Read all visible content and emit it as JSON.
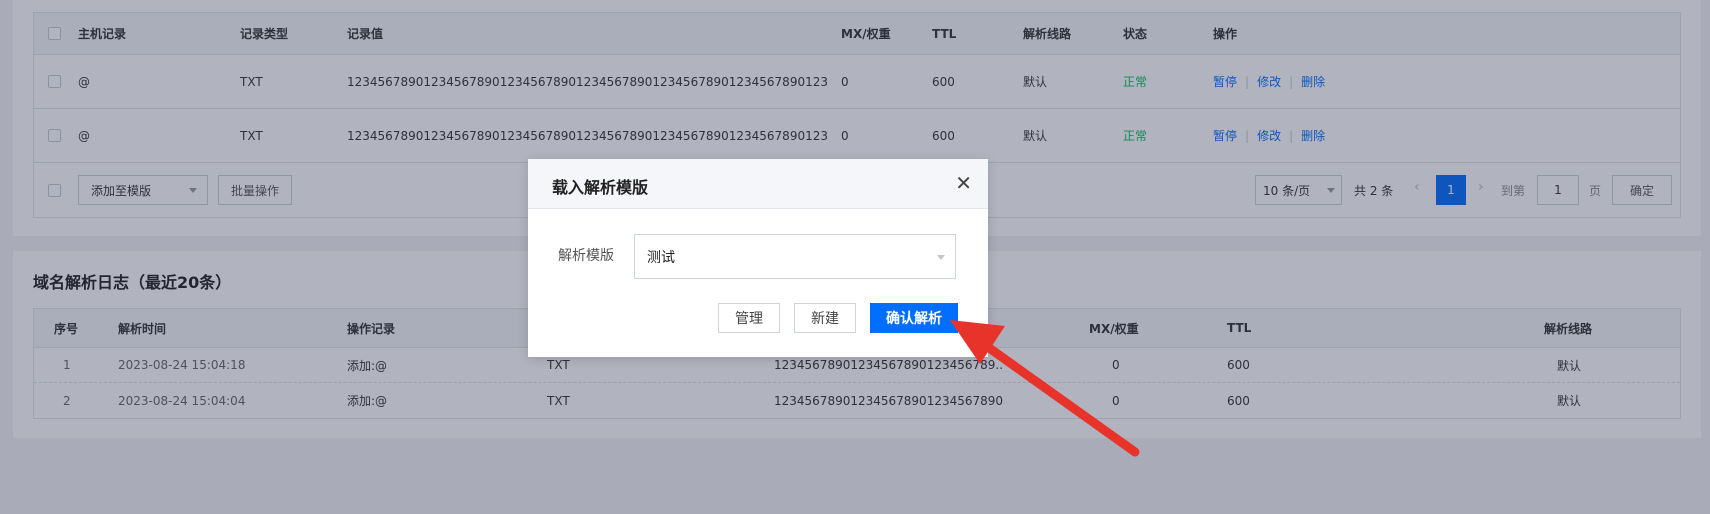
{
  "records_table": {
    "headers": {
      "host": "主机记录",
      "type": "记录类型",
      "value": "记录值",
      "mx": "MX/权重",
      "ttl": "TTL",
      "line": "解析线路",
      "status": "状态",
      "ops": "操作"
    },
    "rows": [
      {
        "host": "@",
        "type": "TXT",
        "value": "12345678901234567890123456789012345678901234567890123456789012345...",
        "mx": "0",
        "ttl": "600",
        "line": "默认",
        "status": "正常"
      },
      {
        "host": "@",
        "type": "TXT",
        "value": "12345678901234567890123456789012345678901234567890123456789012345...",
        "mx": "0",
        "ttl": "600",
        "line": "默认",
        "status": "正常"
      }
    ],
    "ops": {
      "pause": "暂停",
      "edit": "修改",
      "delete": "删除"
    },
    "footer": {
      "add_template": "添加至模版",
      "batch": "批量操作",
      "page_size": "10 条/页",
      "total": "共 2 条",
      "current_page": "1",
      "goto": "到第",
      "goto_value": "1",
      "page_unit": "页",
      "confirm": "确定"
    }
  },
  "log": {
    "title": "域名解析日志（最近20条）",
    "headers": {
      "no": "序号",
      "time": "解析时间",
      "action": "操作记录",
      "mx": "MX/权重",
      "ttl": "TTL",
      "line": "解析线路"
    },
    "rows": [
      {
        "no": "1",
        "time": "2023-08-24 15:04:18",
        "action": "添加:@",
        "type": "TXT",
        "value": "12345678901234567890123456789...",
        "mx": "0",
        "ttl": "600",
        "line": "默认"
      },
      {
        "no": "2",
        "time": "2023-08-24 15:04:04",
        "action": "添加:@",
        "type": "TXT",
        "value": "12345678901234567890123456789012345678901...",
        "mx": "0",
        "ttl": "600",
        "line": "默认"
      }
    ]
  },
  "modal": {
    "title": "载入解析模版",
    "label": "解析模版",
    "selected": "测试",
    "manage": "管理",
    "create": "新建",
    "confirm": "确认解析"
  },
  "colors": {
    "primary": "#006eff",
    "status_ok": "#0abf5b",
    "arrow": "#e8332a"
  }
}
